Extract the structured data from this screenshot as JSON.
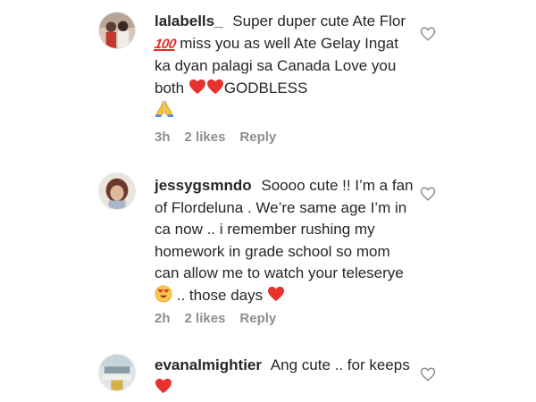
{
  "comments": [
    {
      "username": "lalabells_",
      "text_parts": [
        "Super duper cute Ate Flor",
        "miss you as well Ate Gelay Ingat ka dyan palagi sa Canada Love you both",
        "GODBLESS"
      ],
      "emoji_100": "100",
      "time": "3h",
      "likes": "2 likes",
      "reply": "Reply"
    },
    {
      "username": "jessygsmndo",
      "text_parts": [
        "Soooo cute !! I’m a fan of Flordeluna . We’re same age I’m in ca now .. i remember rushing my homework in grade school so mom can allow me to watch your teleserye",
        ".. those days"
      ],
      "time": "2h",
      "likes": "2 likes",
      "reply": "Reply"
    },
    {
      "username": "evanalmightier",
      "text_parts": [
        "Ang cute .. for keeps"
      ]
    }
  ],
  "colors": {
    "heart_red": "#e8322e",
    "meta_gray": "#8e8e8e",
    "text": "#262626"
  },
  "icons": {
    "like": "heart-outline-icon",
    "emoji_heart": "red-heart-emoji",
    "emoji_pray": "praying-hands-emoji",
    "emoji_hearteyes": "heart-eyes-emoji",
    "emoji_100": "hundred-points-emoji"
  }
}
